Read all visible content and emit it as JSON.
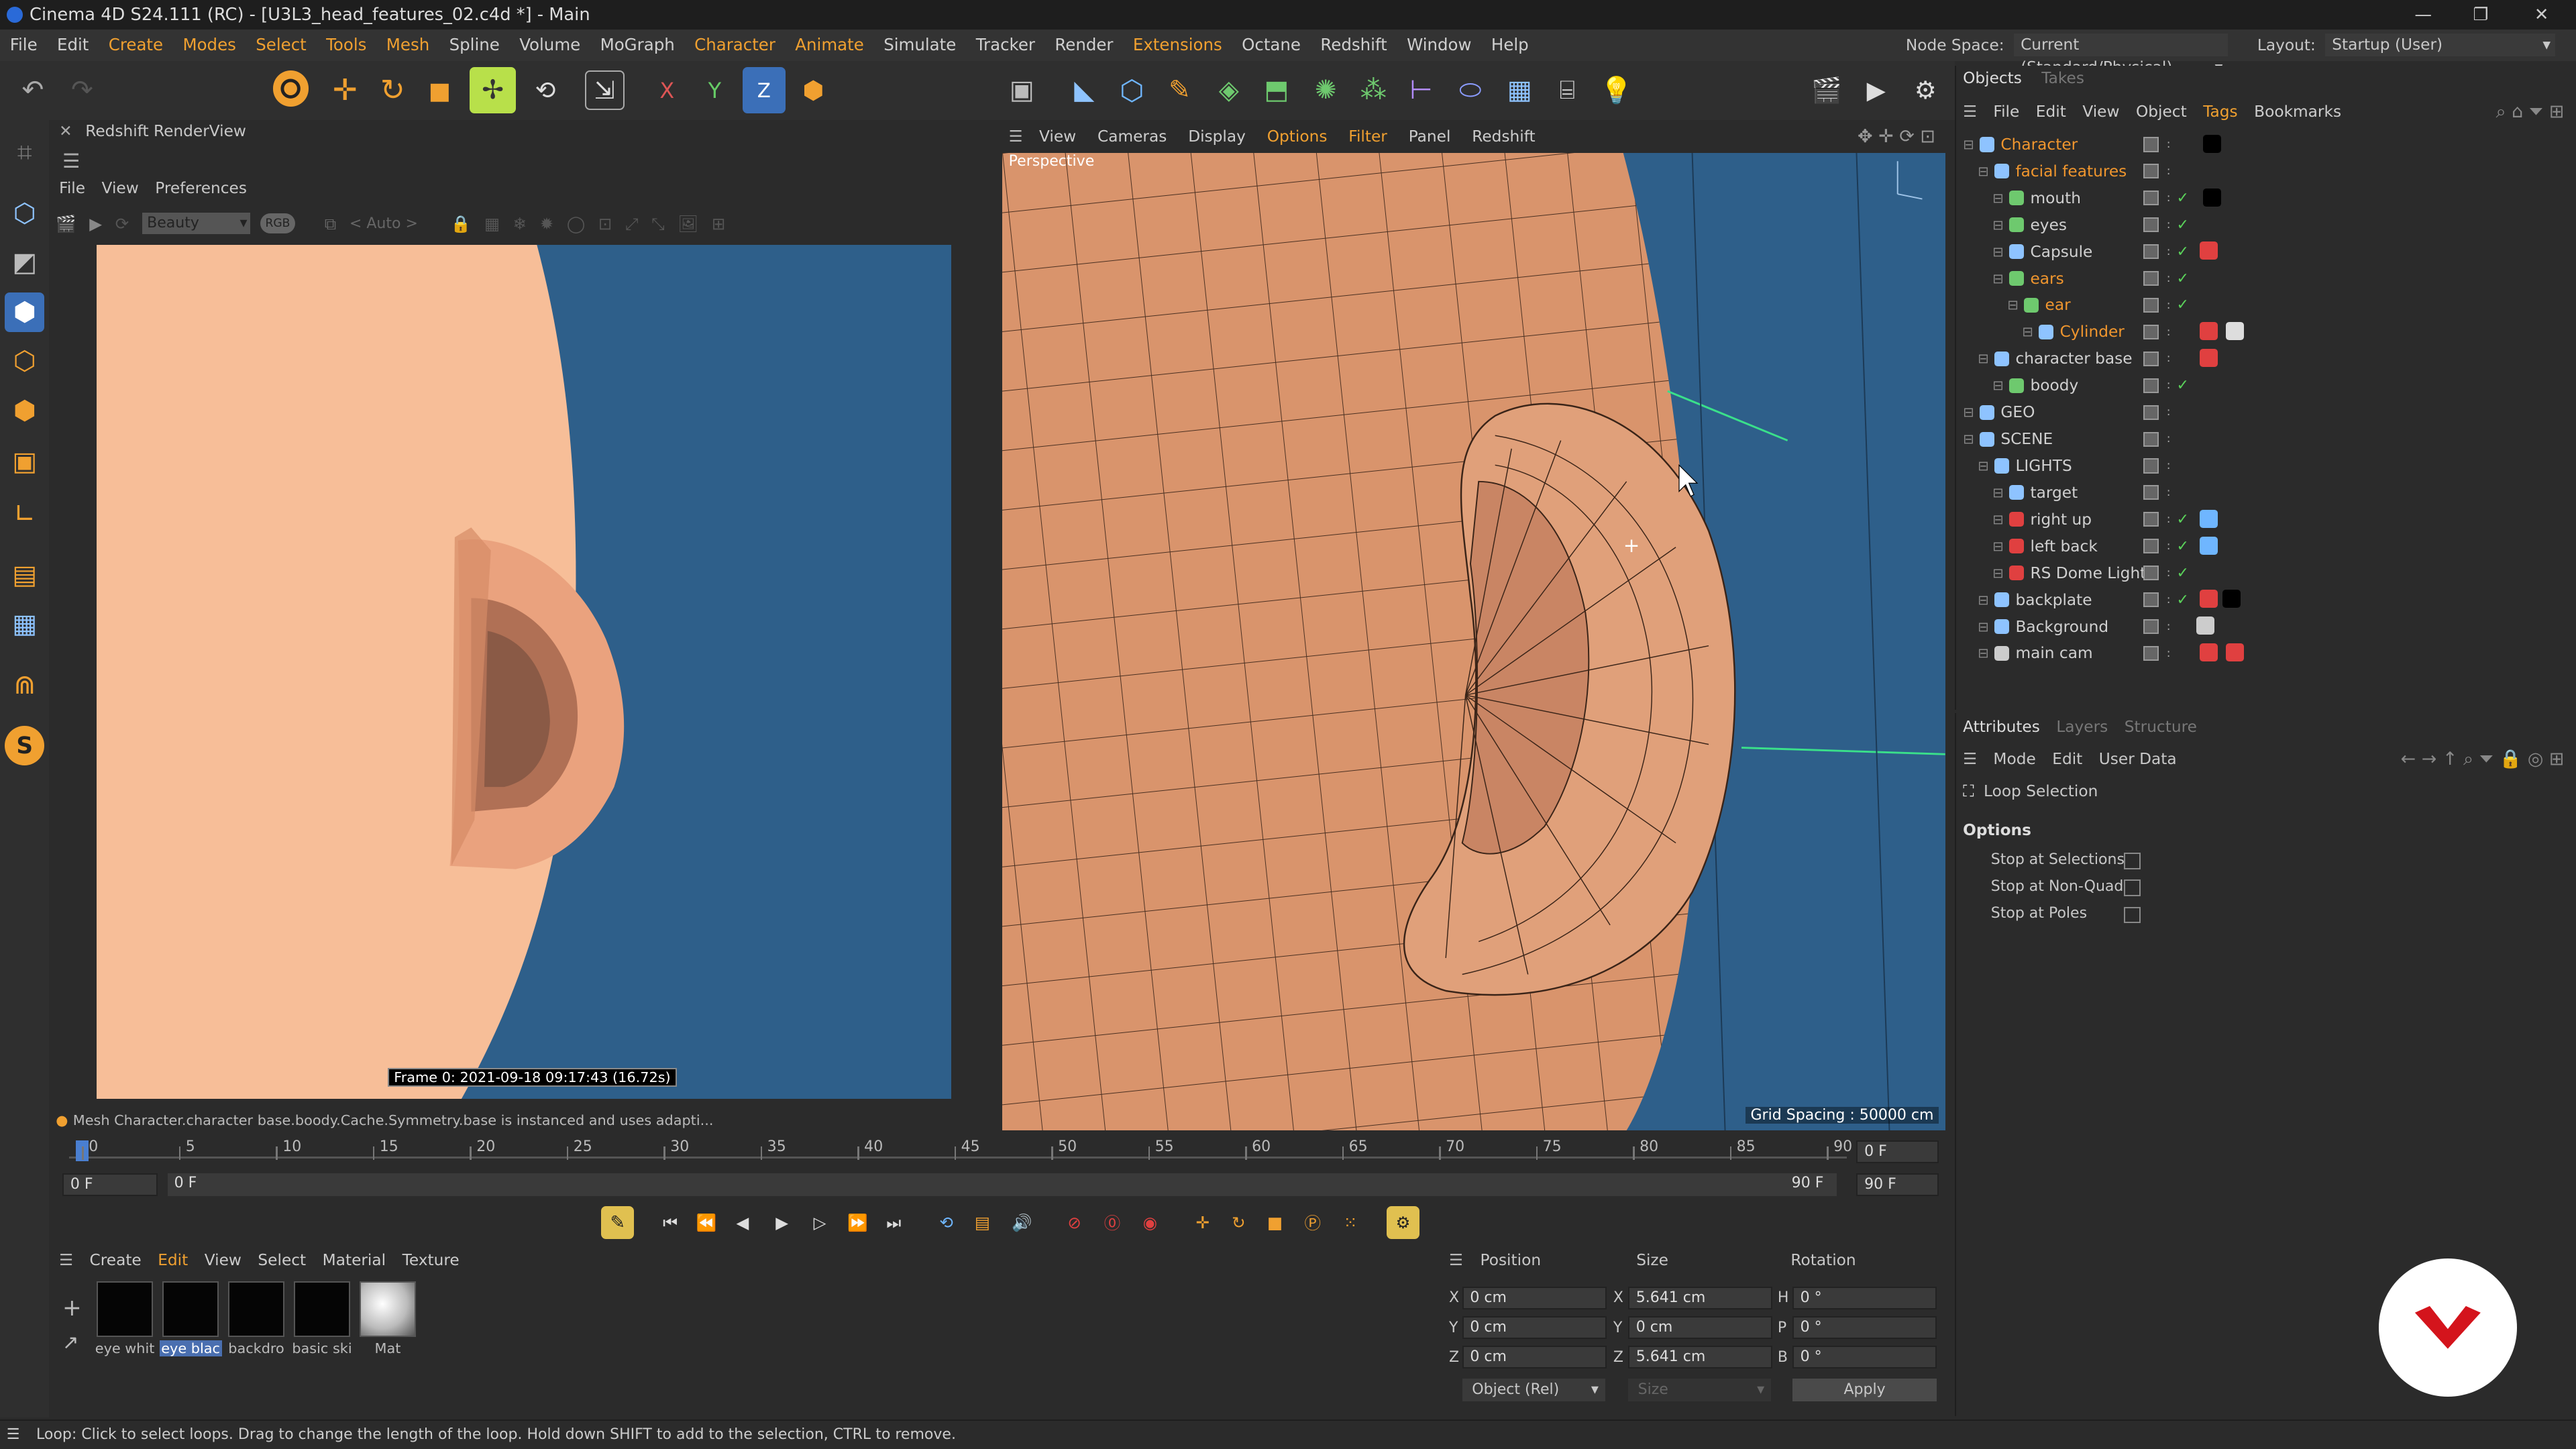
{
  "window": {
    "title": "Cinema 4D S24.111 (RC) - [U3L3_head_features_02.c4d *] - Main",
    "minimize": "—",
    "maximize": "❐",
    "close": "✕"
  },
  "menu": [
    "File",
    "Edit",
    "Create",
    "Modes",
    "Select",
    "Tools",
    "Mesh",
    "Spline",
    "Volume",
    "MoGraph",
    "Character",
    "Animate",
    "Simulate",
    "Tracker",
    "Render",
    "Extensions",
    "Octane",
    "Redshift",
    "Window",
    "Help"
  ],
  "menu_highlight": [
    "Create",
    "Modes",
    "Select",
    "Tools",
    "Mesh",
    "Character",
    "Animate",
    "Extensions"
  ],
  "node_space": {
    "label": "Node Space:",
    "value": "Current (Standard/Physical)"
  },
  "layout": {
    "label": "Layout:",
    "value": "Startup (User)"
  },
  "renderview": {
    "title": "Redshift RenderView",
    "menu": [
      "File",
      "View",
      "Preferences"
    ],
    "aov": "Beauty",
    "auto": "< Auto >",
    "frame_info": "Frame  0:  2021-09-18  09:17:43  (16.72s)"
  },
  "viewport": {
    "menu": [
      "View",
      "Cameras",
      "Display",
      "Options",
      "Filter",
      "Panel",
      "Redshift"
    ],
    "menu_highlight": [
      "Options",
      "Filter"
    ],
    "label": "Perspective",
    "grid_spacing": "Grid Spacing : 50000 cm"
  },
  "status_message": "Mesh Character.character base.boody.Cache.Symmetry.base is instanced and uses adapti...",
  "timeline": {
    "ticks": [
      "0",
      "5",
      "10",
      "15",
      "20",
      "25",
      "30",
      "35",
      "40",
      "45",
      "50",
      "55",
      "60",
      "65",
      "70",
      "75",
      "80",
      "85",
      "90"
    ],
    "current_frame": "0 F",
    "start": "0 F",
    "range_start": "0 F",
    "range_end": "90 F",
    "end": "90 F",
    "max": "90 F"
  },
  "objects_panel": {
    "tabs": [
      "Objects",
      "Takes"
    ],
    "menu": [
      "File",
      "Edit",
      "View",
      "Object",
      "Tags",
      "Bookmarks"
    ],
    "items": [
      {
        "name": "Character",
        "indent": 0,
        "orange": true
      },
      {
        "name": "facial features",
        "indent": 1,
        "orange": true
      },
      {
        "name": "mouth",
        "indent": 2,
        "orange": false
      },
      {
        "name": "eyes",
        "indent": 2,
        "orange": false
      },
      {
        "name": "Capsule",
        "indent": 2,
        "orange": false
      },
      {
        "name": "ears",
        "indent": 2,
        "orange": true
      },
      {
        "name": "ear",
        "indent": 3,
        "orange": true
      },
      {
        "name": "Cylinder",
        "indent": 4,
        "orange": true
      },
      {
        "name": "character base",
        "indent": 1,
        "orange": false
      },
      {
        "name": "boody",
        "indent": 2,
        "orange": false
      },
      {
        "name": "GEO",
        "indent": 0,
        "orange": false
      },
      {
        "name": "SCENE",
        "indent": 0,
        "orange": false
      },
      {
        "name": "LIGHTS",
        "indent": 1,
        "orange": false
      },
      {
        "name": "target",
        "indent": 2,
        "orange": false
      },
      {
        "name": "right up",
        "indent": 2,
        "orange": false
      },
      {
        "name": "left back",
        "indent": 2,
        "orange": false
      },
      {
        "name": "RS Dome Light",
        "indent": 2,
        "orange": false
      },
      {
        "name": "backplate",
        "indent": 1,
        "orange": false
      },
      {
        "name": "Background",
        "indent": 1,
        "orange": false
      },
      {
        "name": "main cam",
        "indent": 1,
        "orange": false
      }
    ]
  },
  "attributes_panel": {
    "tabs": [
      "Attributes",
      "Layers",
      "Structure"
    ],
    "menu": [
      "Mode",
      "Edit",
      "User Data"
    ],
    "tool_name": "Loop Selection",
    "section": "Options",
    "options": [
      "Stop at Selections",
      "Stop at Non-Quads",
      "Stop at Poles"
    ]
  },
  "materials": {
    "menu": [
      "Create",
      "Edit",
      "View",
      "Select",
      "Material",
      "Texture"
    ],
    "items": [
      "eye whit",
      "eye blac",
      "backdro",
      "basic ski",
      "Mat"
    ]
  },
  "coordinates": {
    "headers": [
      "Position",
      "Size",
      "Rotation"
    ],
    "rows": [
      {
        "axis": "X",
        "pos": "0 cm",
        "size_axis": "X",
        "size": "5.641 cm",
        "rot_axis": "H",
        "rot": "0 °"
      },
      {
        "axis": "Y",
        "pos": "0 cm",
        "size_axis": "Y",
        "size": "0 cm",
        "rot_axis": "P",
        "rot": "0 °"
      },
      {
        "axis": "Z",
        "pos": "0 cm",
        "size_axis": "Z",
        "size": "5.641 cm",
        "rot_axis": "B",
        "rot": "0 °"
      }
    ],
    "mode": "Object (Rel)",
    "size_mode": "Size",
    "apply": "Apply"
  },
  "status_bar": "Loop: Click to select loops. Drag to change the length of the loop. Hold down SHIFT to add to the selection, CTRL to remove.",
  "colors": {
    "accent": "#f0962e",
    "viewport_bg": "#2e5f8a",
    "skin": "#d9946c",
    "check": "#5ad25a",
    "brand": "#d4141c"
  }
}
